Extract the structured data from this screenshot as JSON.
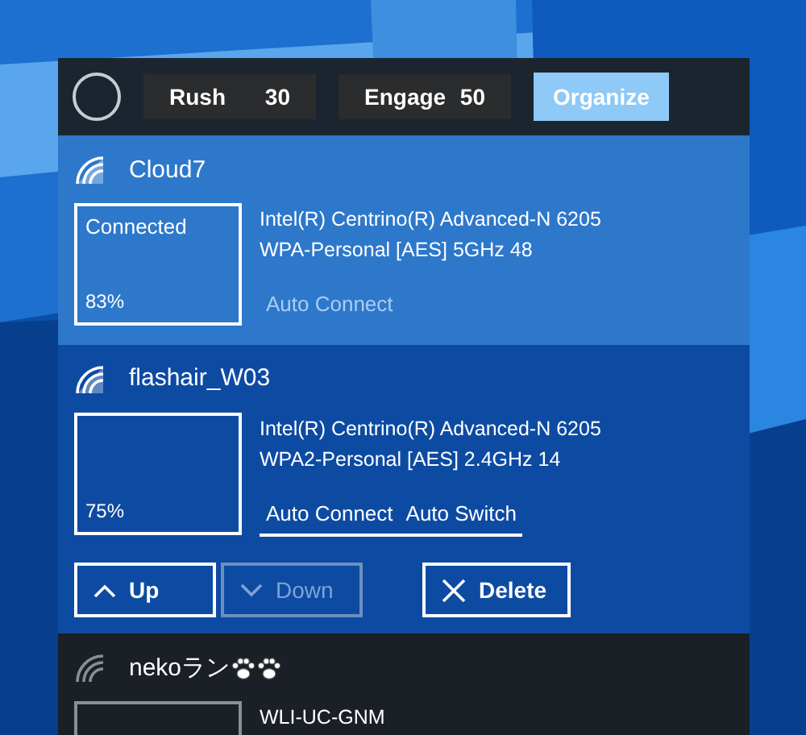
{
  "toolbar": {
    "buttons": [
      {
        "label": "Rush",
        "count": "30",
        "kind": "counter"
      },
      {
        "label": "Engage",
        "count": "50",
        "kind": "counter"
      },
      {
        "label": "Organize",
        "kind": "primary"
      }
    ]
  },
  "networks": [
    {
      "name": "Cloud7",
      "selected": false,
      "connected": true,
      "in_range": true,
      "status": "Connected",
      "signal": "83%",
      "adapter": "Intel(R) Centrino(R) Advanced-N 6205",
      "security": "WPA-Personal [AES] 5GHz 48",
      "options": [
        {
          "label": "Auto Connect",
          "on": false
        }
      ]
    },
    {
      "name": "flashair_W03",
      "selected": true,
      "connected": false,
      "in_range": true,
      "signal": "75%",
      "adapter": "Intel(R) Centrino(R) Advanced-N 6205",
      "security": "WPA2-Personal [AES] 2.4GHz 14",
      "options": [
        {
          "label": "Auto Connect",
          "on": true
        },
        {
          "label": "Auto Switch",
          "on": true
        }
      ],
      "actions": [
        {
          "label": "Up",
          "kind": "up",
          "disabled": false
        },
        {
          "label": "Down",
          "kind": "down",
          "disabled": true
        },
        {
          "label": "Delete",
          "kind": "delete",
          "disabled": false
        }
      ]
    },
    {
      "name": "nekoラン",
      "badges": [
        {
          "kind": "paw"
        },
        {
          "kind": "paw"
        }
      ],
      "selected": false,
      "connected": false,
      "in_range": false,
      "adapter": "WLI-UC-GNM"
    }
  ]
}
